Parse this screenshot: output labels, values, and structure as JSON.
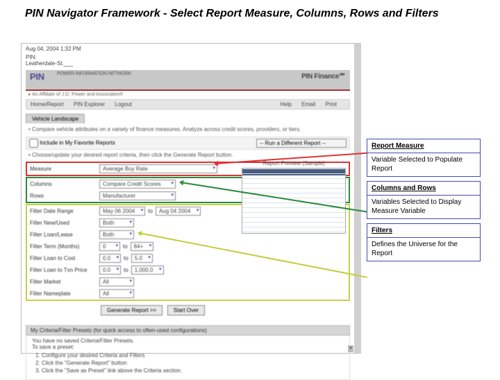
{
  "title": "PIN Navigator Framework - Select Report Measure, Columns, Rows and Filters",
  "hdr": {
    "date": "Aug 04, 2004    1:32 PM",
    "pin": "PIN:",
    "dealer": "Leatherdale-St.___"
  },
  "banner": {
    "logo": "PIN",
    "tag": "POWER INFORMATION NETWORK",
    "right": "PIN Finance℠"
  },
  "affiliate": "▸ An Affiliate of J.D. Power and Associates®",
  "nav": {
    "l1": "Home/Report",
    "l2": "PIN Explorer",
    "l3": "Logout",
    "r1": "Help",
    "r2": "Email",
    "r3": "Print"
  },
  "tab": "Vehicle Landscape",
  "desc": "• Compare vehicle attributes on a variety of finance measures. Analyze across credit scores, providers, or tiers.",
  "fav": {
    "label": "Include in My Favorite Reports",
    "run": "-- Run a Different Report --"
  },
  "note": "• Choose/update your desired report criteria, then click the Generate Report button.",
  "preview_title": "Report Preview (Sample)",
  "form": {
    "measure_label": "Measure",
    "measure_val": "Average Buy Rate",
    "columns_label": "Columns",
    "columns_val": "Compare Credit Scores",
    "rows_label": "Rows",
    "rows_val": "Manufacturer",
    "f_dr_label": "Filter Date Range",
    "f_dr_v1": "May 06 2004",
    "f_to": "to",
    "f_dr_v2": "Aug 04 2004",
    "f_nu_label": "Filter New/Used",
    "f_nu_val": "Both",
    "f_ll_label": "Filter Loan/Lease",
    "f_ll_val": "Both",
    "f_tm_label": "Filter Term (Months)",
    "f_tm_v1": "0",
    "f_tm_v2": "84+",
    "f_lc_label": "Filter Loan to Cost",
    "f_lc_v1": "0.0",
    "f_lc_v2": "5.0",
    "f_lt_label": "Filter Loan to Txn Price",
    "f_lt_v1": "0.0",
    "f_lt_v2": "1,000.0",
    "f_mk_label": "Filter Market",
    "f_mk_val": "All",
    "f_np_label": "Filter Nameplate",
    "f_np_val": "All"
  },
  "btns": {
    "gen": "Generate Report >>",
    "start": "Start Over"
  },
  "preset": {
    "hdr": "My Criteria/Filter Presets   (for quick access to often-used configurations)",
    "note": "You have no saved Criteria/Filter Presets.\nTo save a preset:",
    "s1": "Configure your desired Criteria and Filters",
    "s2": "Click the \"Generate Report\" button",
    "s3": "Click the \"Save as Preset\" link above the Criteria section."
  },
  "co": {
    "t1": "Report Measure",
    "b1": "Variable Selected to Populate Report",
    "t2": "Columns and Rows",
    "b2": "Variables Selected to Display Measure Variable",
    "t3": "Filters",
    "b3": "Defines the Universe for the Report"
  }
}
